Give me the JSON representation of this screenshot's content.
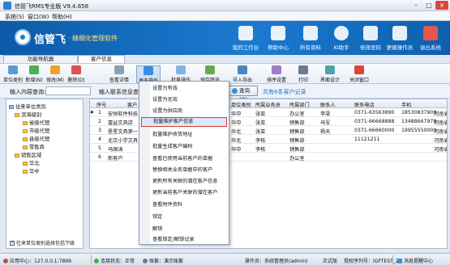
{
  "window": {
    "title": "信管飞RMS专业版 V9.4.658"
  },
  "menubar": {
    "items": [
      "系统(S)",
      "窗口(W)",
      "帮助(H)"
    ]
  },
  "banner": {
    "logo_name": "信管飞",
    "tagline": "· 精细化管理软件",
    "buttons": [
      "我的工作台",
      "帮助中心",
      "所有资料",
      "KI助手",
      "修改密码",
      "更换操作员",
      "退出系统"
    ]
  },
  "tabs": [
    "功能导航器",
    "客户信息"
  ],
  "toolbar": {
    "buttons": [
      "单位类别",
      "新增(N)",
      "修改(M)",
      "删除(D)",
      "查看详情",
      "更多操作",
      "批量操作",
      "保存筛选",
      "导入导出",
      "排序设置",
      "打印",
      "界面设计",
      "关闭窗口"
    ]
  },
  "filter": {
    "input_label": "输入内容查询:",
    "input2_label": "输入联系信息查询:",
    "query_button": "查询(Q)",
    "hint": "共有6条客户记录"
  },
  "tree": {
    "root": "往来单位类别",
    "nodes": [
      "滨海级别",
      "省级代理",
      "市级代理",
      "县级代理",
      "零售商",
      "销售区域",
      "华北",
      "华中"
    ],
    "footer_checkbox": "往来单位类别选择包括下级"
  },
  "grid": {
    "columns": [
      "序号",
      "客户",
      "单位类别",
      "所属业务员",
      "所属部门",
      "联系人",
      "联系电话",
      "手机",
      ""
    ],
    "rows": [
      {
        "no": "1",
        "name": "宏恒软件科技",
        "cat": "华中",
        "staff": "张亚",
        "dept": "办公室",
        "contact": "李梁",
        "tel": "0371-63563890",
        "mobile": "18530837908",
        "area": "河南省"
      },
      {
        "no": "2",
        "name": "富益文具店",
        "cat": "华中",
        "staff": "张亚",
        "dept": "销售部",
        "contact": "马军",
        "tel": "0371-66668888",
        "mobile": "13488667978",
        "area": "河南省"
      },
      {
        "no": "3",
        "name": "星星文具第一",
        "cat": "华北",
        "staff": "张亚",
        "dept": "销售部",
        "contact": "杨天",
        "tel": "0371-66660000",
        "mobile": "19955550000",
        "area": "河南省"
      },
      {
        "no": "4",
        "name": "北京小学文具",
        "cat": "华北",
        "staff": "李柘",
        "dept": "销售部",
        "contact": "",
        "tel": "11121211",
        "mobile": "",
        "area": "河南省"
      },
      {
        "no": "5",
        "name": "马国涛",
        "cat": "华中",
        "staff": "李柘",
        "dept": "销售部",
        "contact": "",
        "tel": "",
        "mobile": "",
        "area": "河南省"
      },
      {
        "no": "6",
        "name": "新客户",
        "cat": "",
        "staff": "",
        "dept": "办公室",
        "contact": "",
        "tel": "",
        "mobile": "",
        "area": ""
      }
    ]
  },
  "more_menu": {
    "items": [
      "设置为有效",
      "设置为无效",
      "设置为供应商",
      "批量维护客户信息",
      "批量维护收货地址",
      "批量生成客户编码",
      "查看已使用当前客户的单据",
      "替换相关业务单据中的客户",
      "更新所有关联的潜在客户信息",
      "更新当前客户关联的潜在客户",
      "查看附件资料",
      "锁定",
      "解锁",
      "查看锁定/解锁记录"
    ],
    "highlighted_index": 3
  },
  "statusbar": {
    "server": "应用中心：127.0.0.1:7899",
    "connection": "连接状态：正常",
    "account": "账套：演示账套",
    "operator": "操作员：系统管理员(admin)",
    "edition": "正式版",
    "license": "授权序列号：IGFTEST_2",
    "news": "消息提醒中心"
  },
  "colors": {
    "banner": "#1b7bd0",
    "highlight_border": "#d83a32",
    "hint_text": "#2a6ec8"
  }
}
